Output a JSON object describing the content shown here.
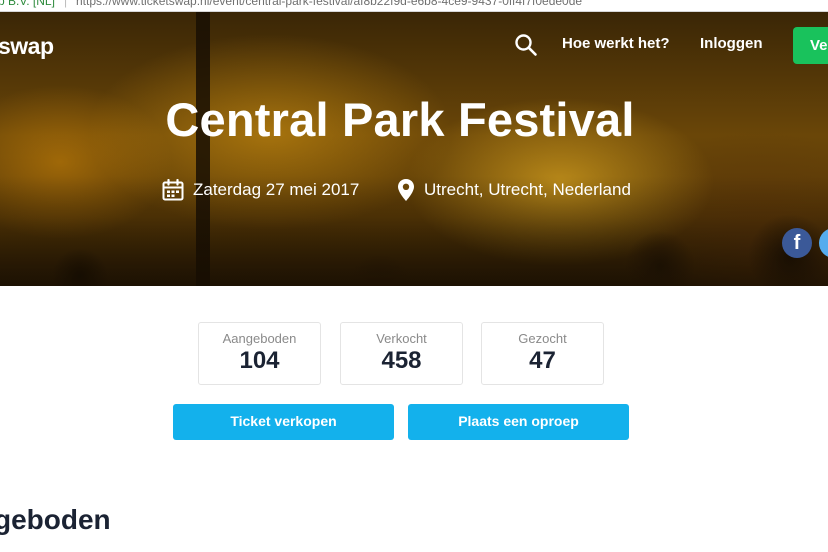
{
  "browser": {
    "secure_label": "p B.V. [NL]",
    "separator": "|",
    "url": "https://www.ticketswap.nl/event/central-park-festival/af8b22f9d-e6b8-4ce9-9437-0ff4f7f0ede0de"
  },
  "header": {
    "logo_text": "swap",
    "search_icon": "search-icon",
    "nav": {
      "how_it_works": "Hoe werkt het?",
      "login": "Inloggen",
      "sell_button": "Ve"
    }
  },
  "event": {
    "title": "Central Park Festival",
    "date": "Zaterdag 27 mei 2017",
    "location": "Utrecht, Utrecht, Nederland",
    "date_icon": "calendar-icon",
    "location_icon": "map-pin-icon"
  },
  "share": {
    "facebook_glyph": "f",
    "facebook_icon": "facebook-icon",
    "twitter_icon": "twitter-icon"
  },
  "stats": [
    {
      "label": "Aangeboden",
      "value": "104"
    },
    {
      "label": "Verkocht",
      "value": "458"
    },
    {
      "label": "Gezocht",
      "value": "47"
    }
  ],
  "actions": {
    "sell_ticket": "Ticket verkopen",
    "place_request": "Plaats een oproep"
  },
  "section": {
    "heading": "geboden"
  },
  "colors": {
    "primary_cta": "#13b1ec",
    "sell_green": "#19c25c",
    "facebook": "#3b5998",
    "twitter": "#55acee",
    "stat_number": "#1b2333"
  }
}
